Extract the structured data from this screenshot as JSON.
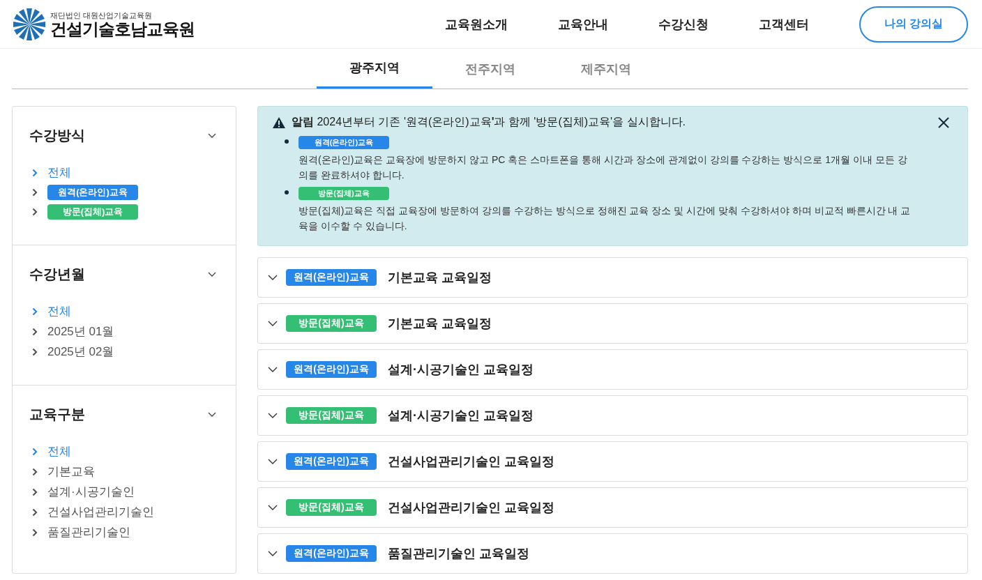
{
  "header": {
    "logo_subtitle": "재단법인 대원산업기술교육원",
    "logo_title": "건설기술호남교육원",
    "nav": [
      "교육원소개",
      "교육안내",
      "수강신청",
      "고객센터"
    ],
    "my_button": "나의 강의실"
  },
  "region_tabs": [
    {
      "label": "광주지역",
      "selected": true
    },
    {
      "label": "전주지역",
      "selected": false
    },
    {
      "label": "제주지역",
      "selected": false
    }
  ],
  "sidebar": [
    {
      "title": "수강방식",
      "items": [
        {
          "kind": "text",
          "label": "전체",
          "selected": true
        },
        {
          "kind": "online",
          "label": "원격(온라인)교육",
          "selected": false
        },
        {
          "kind": "offline",
          "label": "방문(집체)교육",
          "selected": false
        }
      ]
    },
    {
      "title": "수강년월",
      "items": [
        {
          "kind": "text",
          "label": "전체",
          "selected": true
        },
        {
          "kind": "text",
          "label": "2025년 01월",
          "selected": false
        },
        {
          "kind": "text",
          "label": "2025년 02월",
          "selected": false
        }
      ]
    },
    {
      "title": "교육구분",
      "items": [
        {
          "kind": "text",
          "label": "전체",
          "selected": true
        },
        {
          "kind": "text",
          "label": "기본교육",
          "selected": false
        },
        {
          "kind": "text",
          "label": "설계·시공기술인",
          "selected": false
        },
        {
          "kind": "text",
          "label": "건설사업관리기술인",
          "selected": false
        },
        {
          "kind": "text",
          "label": "품질관리기술인",
          "selected": false
        }
      ]
    }
  ],
  "notice": {
    "text": "**알림** 2024년부터 기존 '원격(온라인)교육**'**과 함께 '방문(집체)교육'을 실시합니다.",
    "items": [
      {
        "kind": "online",
        "label": "원격(온라인)교육",
        "description": "원격(온라인)교육은 교육장에 방문하지 않고 PC 혹은 스마트폰을 통해 시간과 장소에 관계없이 강의를 수강하는 방식으로 1개월 이내 모든 강의를 완료하셔야 합니다."
      },
      {
        "kind": "offline",
        "label": "방문(집체)교육",
        "description": "방문(집체)교육은 직접 교육장에 방문하여 강의를 수강하는 방식으로 정해진 교육 장소 및 시간에 맞춰 수강하셔야 하며 비교적 빠른시간 내 교육을 이수할 수 있습니다."
      }
    ]
  },
  "schedules": [
    {
      "kind": "online",
      "label": "원격(온라인)교육",
      "title": "기본교육 교육일정"
    },
    {
      "kind": "offline",
      "label": "방문(집체)교육",
      "title": "기본교육 교육일정"
    },
    {
      "kind": "online",
      "label": "원격(온라인)교육",
      "title": "설계·시공기술인 교육일정"
    },
    {
      "kind": "offline",
      "label": "방문(집체)교육",
      "title": "설계·시공기술인 교육일정"
    },
    {
      "kind": "online",
      "label": "원격(온라인)교육",
      "title": "건설사업관리기술인 교육일정"
    },
    {
      "kind": "offline",
      "label": "방문(집체)교육",
      "title": "건설사업관리기술인 교육일정"
    },
    {
      "kind": "online",
      "label": "원격(온라인)교육",
      "title": "품질관리기술인 교육일정"
    }
  ]
}
